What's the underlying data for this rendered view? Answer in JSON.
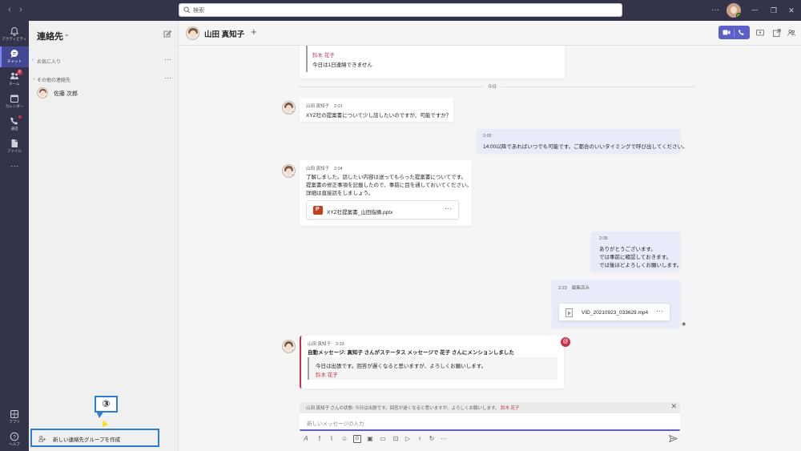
{
  "titlebar": {
    "search_placeholder": "検索",
    "more": "···",
    "minimize": "—",
    "maximize": "❐",
    "close": "✕"
  },
  "rail": {
    "items": [
      {
        "label": "アクティビティ",
        "icon": "bell-icon"
      },
      {
        "label": "チャット",
        "icon": "chat-icon"
      },
      {
        "label": "チーム",
        "icon": "teams-icon",
        "badge": "8"
      },
      {
        "label": "カレンダー",
        "icon": "calendar-icon"
      },
      {
        "label": "通話",
        "icon": "phone-icon"
      },
      {
        "label": "ファイル",
        "icon": "file-icon"
      },
      {
        "label": "···",
        "icon": "more-icon"
      }
    ],
    "bottom": [
      {
        "label": "アプリ",
        "icon": "apps-icon"
      },
      {
        "label": "ヘルプ",
        "icon": "help-icon"
      }
    ]
  },
  "contacts": {
    "title": "連絡先",
    "groups": [
      {
        "label": "お気に入り"
      },
      {
        "label": "その他の連絡先"
      }
    ],
    "contact_name": "佐藤 次郎",
    "new_group_label": "新しい連絡先グループを作成",
    "callout": "③"
  },
  "chat_header": {
    "name": "山田 真知子",
    "add": "+"
  },
  "messages": {
    "top_quote_name": "鈴木 花子",
    "top_quote_text": "今日は1日連絡できません",
    "divider": "今日",
    "m1": {
      "sender": "山田 真知子",
      "time": "2:01",
      "text": "XYZ社の提案書について少し話したいのですが、可能ですか？"
    },
    "m2": {
      "time": "2:02",
      "text": "14:00以降であればいつでも可能です。ご都合のいいタイミングで呼び出してください。"
    },
    "m3": {
      "sender": "山田 真知子",
      "time": "2:04",
      "lines": [
        "了解しました。話したい内容は送ってもらった提案書についてです。",
        "提案書の修正事項を記載したので、事前に目を通しておいてください。",
        "詳細は直接話をしましょう。"
      ],
      "file": "XYZ社提案書_山田指摘.pptx"
    },
    "m4": {
      "time": "2:05",
      "lines": [
        "ありがとうございます。",
        "では事前に確認しておきます。",
        "では後ほどよろしくお願いします。"
      ]
    },
    "m5": {
      "time": "2:23",
      "edited": "編集済み",
      "file": "VID_20210923_033629.mp4"
    },
    "m6": {
      "sender": "山田 真知子",
      "time": "3:33",
      "auto": "自動メッセージ: 真知子 さんがステータス メッセージで 花子 さんにメンションしました",
      "quote_text": "今日は出張です。回答が遅くなると思いますが、よろしくお願いします。",
      "quote_name": "鈴木 花子"
    },
    "file_more": "···",
    "mention": "@"
  },
  "compose": {
    "status_prefix": "山田 真知子 さんの状態: 今日は出張です。回答が遅くなると思いますが、よろしくお願いします。",
    "status_name": "鈴木 花子",
    "placeholder": "新しいメッセージの入力",
    "more_tools": "···"
  },
  "colors": {
    "rail": "#33344a",
    "accent": "#5b5fc7",
    "mention": "#c4314b",
    "callout": "#2f7dd1"
  }
}
